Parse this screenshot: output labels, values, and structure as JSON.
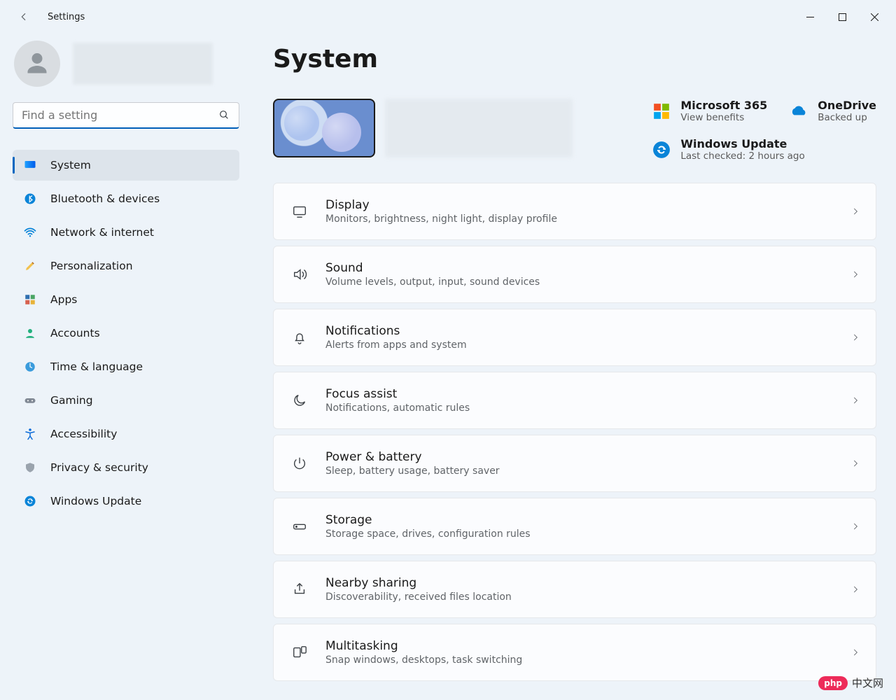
{
  "window": {
    "app_name": "Settings"
  },
  "search": {
    "placeholder": "Find a setting"
  },
  "sidebar": {
    "items": [
      {
        "label": "System"
      },
      {
        "label": "Bluetooth & devices"
      },
      {
        "label": "Network & internet"
      },
      {
        "label": "Personalization"
      },
      {
        "label": "Apps"
      },
      {
        "label": "Accounts"
      },
      {
        "label": "Time & language"
      },
      {
        "label": "Gaming"
      },
      {
        "label": "Accessibility"
      },
      {
        "label": "Privacy & security"
      },
      {
        "label": "Windows Update"
      }
    ]
  },
  "page": {
    "title": "System"
  },
  "status": {
    "m365": {
      "title": "Microsoft 365",
      "sub": "View benefits"
    },
    "onedrive": {
      "title": "OneDrive",
      "sub": "Backed up"
    },
    "wu": {
      "title": "Windows Update",
      "sub": "Last checked: 2 hours ago"
    }
  },
  "tiles": [
    {
      "title": "Display",
      "sub": "Monitors, brightness, night light, display profile"
    },
    {
      "title": "Sound",
      "sub": "Volume levels, output, input, sound devices"
    },
    {
      "title": "Notifications",
      "sub": "Alerts from apps and system"
    },
    {
      "title": "Focus assist",
      "sub": "Notifications, automatic rules"
    },
    {
      "title": "Power & battery",
      "sub": "Sleep, battery usage, battery saver"
    },
    {
      "title": "Storage",
      "sub": "Storage space, drives, configuration rules"
    },
    {
      "title": "Nearby sharing",
      "sub": "Discoverability, received files location"
    },
    {
      "title": "Multitasking",
      "sub": "Snap windows, desktops, task switching"
    }
  ],
  "watermark": {
    "badge": "php",
    "text": "中文网"
  }
}
